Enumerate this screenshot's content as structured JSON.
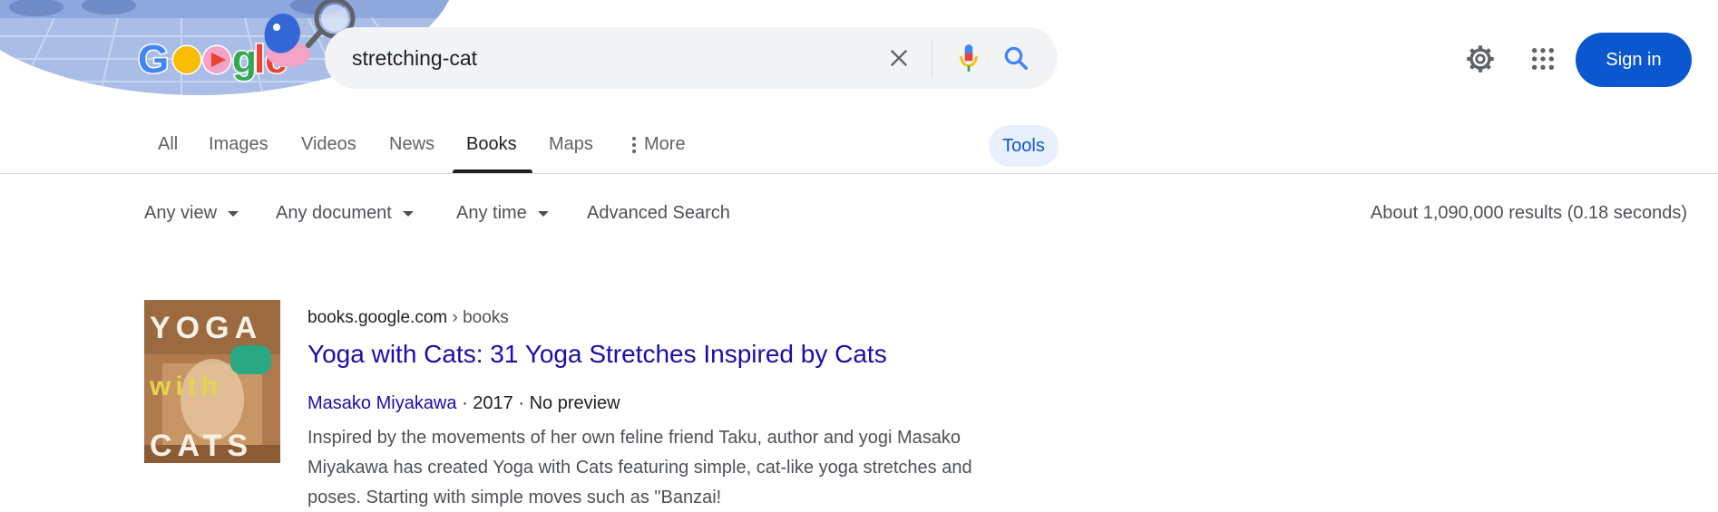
{
  "search": {
    "query": "stretching-cat",
    "logo_text": "Google"
  },
  "header": {
    "signin_label": "Sign in"
  },
  "tabs": [
    {
      "label": "All"
    },
    {
      "label": "Images"
    },
    {
      "label": "Videos"
    },
    {
      "label": "News"
    },
    {
      "label": "Books",
      "active": true
    },
    {
      "label": "Maps"
    }
  ],
  "more_label": "More",
  "tools_label": "Tools",
  "filters": {
    "view": "Any view",
    "document": "Any document",
    "time": "Any time",
    "advanced": "Advanced Search"
  },
  "stats": "About 1,090,000 results (0.18 seconds)",
  "result": {
    "domain": "books.google.com",
    "path": " › books",
    "title": "Yoga with Cats: 31 Yoga Stretches Inspired by Cats",
    "author": "Masako Miyakawa",
    "year": "2017",
    "preview": "No preview",
    "snippet": "Inspired by the movements of her own feline friend Taku, author and yogi Masako Miyakawa has created Yoga with Cats featuring simple, cat-like yoga stretches and poses. Starting with simple moves such as \"Banzai!",
    "cover": {
      "line1": "YOGA",
      "line2": "with",
      "line3": "CATS"
    }
  },
  "colors": {
    "link": "#1a0dab",
    "accent": "#0b57d0",
    "tools_bg": "#e8f0fe"
  }
}
